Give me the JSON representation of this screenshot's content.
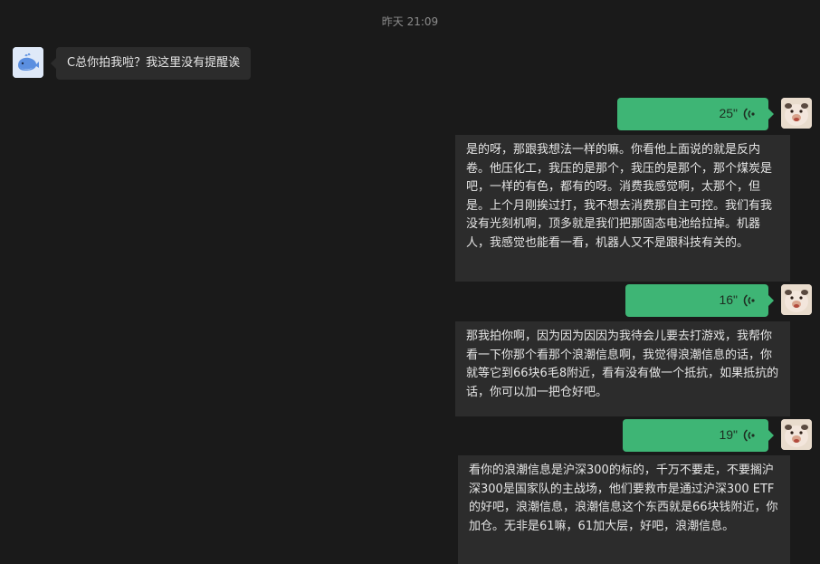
{
  "chat": {
    "timestamp": "昨天 21:09",
    "incoming": {
      "text": "C总你拍我啦？我这里没有提醒诶"
    },
    "outgoing": [
      {
        "duration": "25\"",
        "transcript": "是的呀，那跟我想法一样的嘛。你看他上面说的就是反内卷。他压化工，我压的是那个，我压的是那个，那个煤炭是吧，一样的有色，都有的呀。消费我感觉啊，太那个，但是。上个月刚挨过打，我不想去消费那自主可控。我们有我没有光刻机啊，顶多就是我们把那固态电池给拉掉。机器人，我感觉也能看一看，机器人又不是跟科技有关的。"
      },
      {
        "duration": "16\"",
        "transcript": "那我拍你啊，因为因为因因为我待会儿要去打游戏，我帮你看一下你那个看那个浪潮信息啊，我觉得浪潮信息的话，你就等它到66块6毛8附近，看有没有做一个抵抗，如果抵抗的话，你可以加一把仓好吧。"
      },
      {
        "duration": "19\"",
        "transcript": "看你的浪潮信息是沪深300的标的，千万不要走，不要搁沪深300是国家队的主战场，他们要救市是通过沪深300 ETF的好吧，浪潮信息，浪潮信息这个东西就是66块钱附近，你加仓。无非是61嘛，61加大层，好吧，浪潮信息。"
      }
    ]
  },
  "colors": {
    "background": "#1a1a1a",
    "bubble_in": "#2c2c2c",
    "voice_bubble": "#3eb575"
  },
  "icons": {
    "left_avatar": "whale-avatar",
    "right_avatar": "pig-avatar",
    "voice": "voice-wave-icon"
  }
}
